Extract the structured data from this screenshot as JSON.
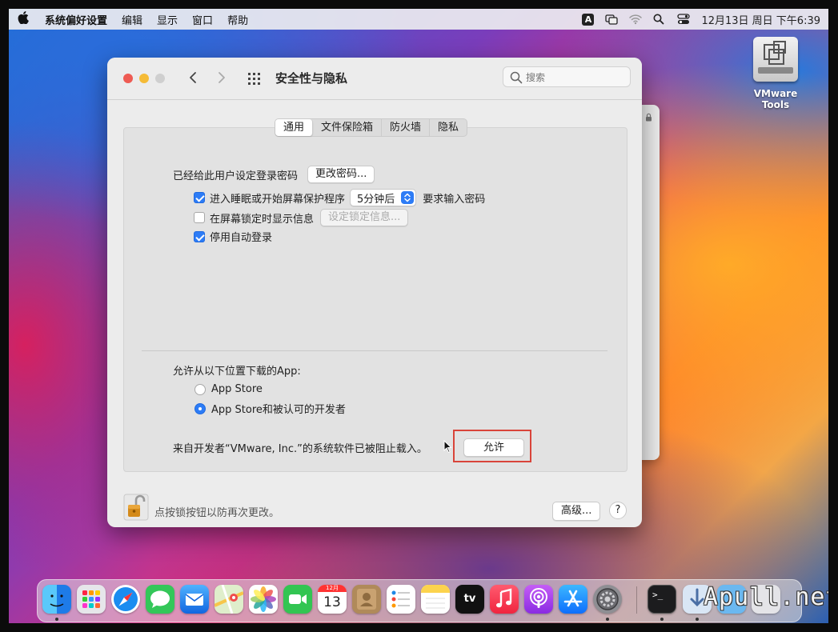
{
  "menubar": {
    "apple": "",
    "items": [
      "系统偏好设置",
      "编辑",
      "显示",
      "窗口",
      "帮助"
    ],
    "ime": "A",
    "clock": "12月13日 周日 下午6:39"
  },
  "desktop": {
    "vmware_label": "VMware Tools"
  },
  "window": {
    "title": "安全性与隐私",
    "search_placeholder": "搜索",
    "tabs": [
      "通用",
      "文件保险箱",
      "防火墙",
      "隐私"
    ],
    "active_tab": "通用",
    "password_label": "已经给此用户设定登录密码",
    "change_password_button": "更改密码...",
    "require_password": {
      "label": "进入睡眠或开始屏幕保护程序",
      "checked": true,
      "delay": "5分钟后",
      "suffix": "要求输入密码"
    },
    "show_message": {
      "label": "在屏幕锁定时显示信息",
      "checked": false,
      "button": "设定锁定信息..."
    },
    "disable_autologin": {
      "label": "停用自动登录",
      "checked": true
    },
    "allow_apps_label": "允许从以下位置下载的App:",
    "radio_options": [
      {
        "label": "App Store",
        "selected": false
      },
      {
        "label": "App Store和被认可的开发者",
        "selected": true
      }
    ],
    "blocked_message": "来自开发者“VMware, Inc.”的系统软件已被阻止载入。",
    "allow_button": "允许",
    "lock_message": "点按锁按钮以防再次更改。",
    "advanced_button": "高级...",
    "help_button": "?"
  },
  "dock": {
    "calendar_month": "12月",
    "calendar_day": "13",
    "tv_label": "tv",
    "terminal_prompt": ">_",
    "apps": [
      "Finder",
      "Launchpad",
      "Safari",
      "Messages",
      "Mail",
      "Maps",
      "Photos",
      "FaceTime",
      "Calendar",
      "Contacts",
      "Reminders",
      "Notes",
      "TV",
      "Music",
      "Podcasts",
      "App Store",
      "System Preferences",
      "Terminal",
      "Downloads",
      "Folder",
      "Trash"
    ]
  },
  "watermark": "Apull.net"
}
